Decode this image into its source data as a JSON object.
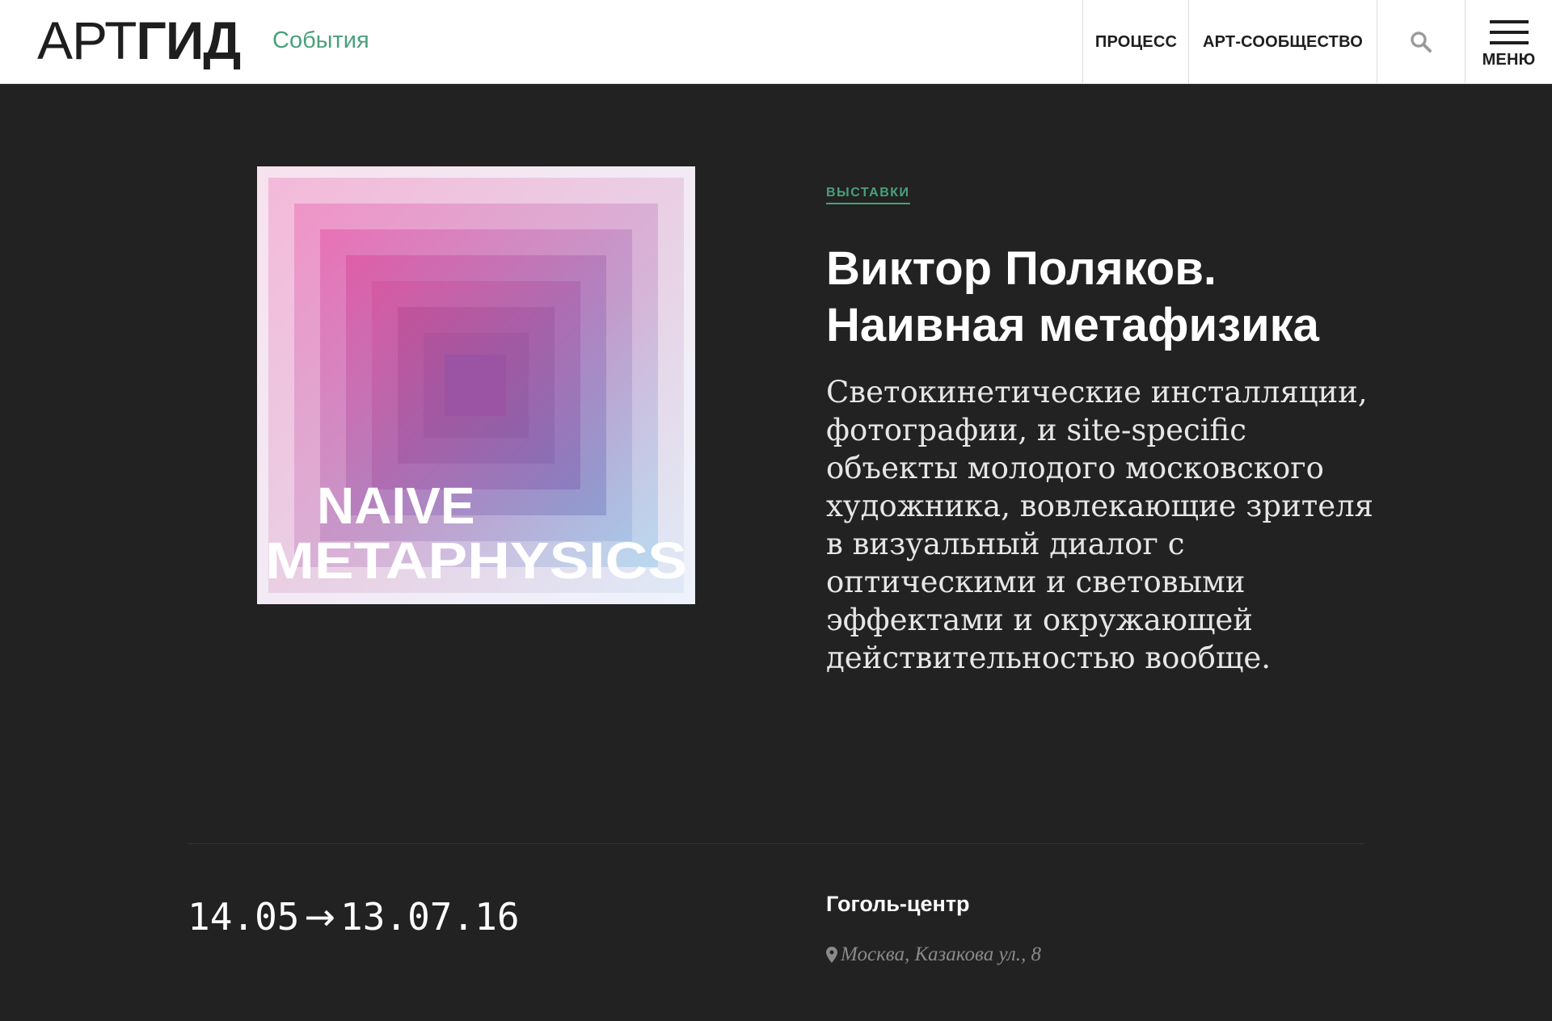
{
  "header": {
    "logo_light": "АРТ",
    "logo_bold": "ГИД",
    "section": "События",
    "nav": [
      "ПРОЦЕСС",
      "АРТ-СООБЩЕСТВО"
    ],
    "menu_label": "МЕНЮ"
  },
  "poster": {
    "line1": "NAIVE",
    "line2": "METAPHYSICS"
  },
  "event": {
    "category": "ВЫСТАВКИ",
    "title_line1": "Виктор Поляков.",
    "title_line2": "Наивная метафизика",
    "description": "Светокинетические инсталляции, фотографии, и site-specific объекты молодого московского художника, вовлекающие зрителя в визуальный диалог с оптическими и световыми эффектами и окружающей действительностью вообще.",
    "date_start": "14.05",
    "date_arrow": "→",
    "date_end": "13.07.16",
    "venue": "Гоголь-центр",
    "address": "Москва, Казакова ул., 8"
  },
  "colors": {
    "accent": "#4aa07c",
    "background": "#222222",
    "header_bg": "#ffffff"
  }
}
